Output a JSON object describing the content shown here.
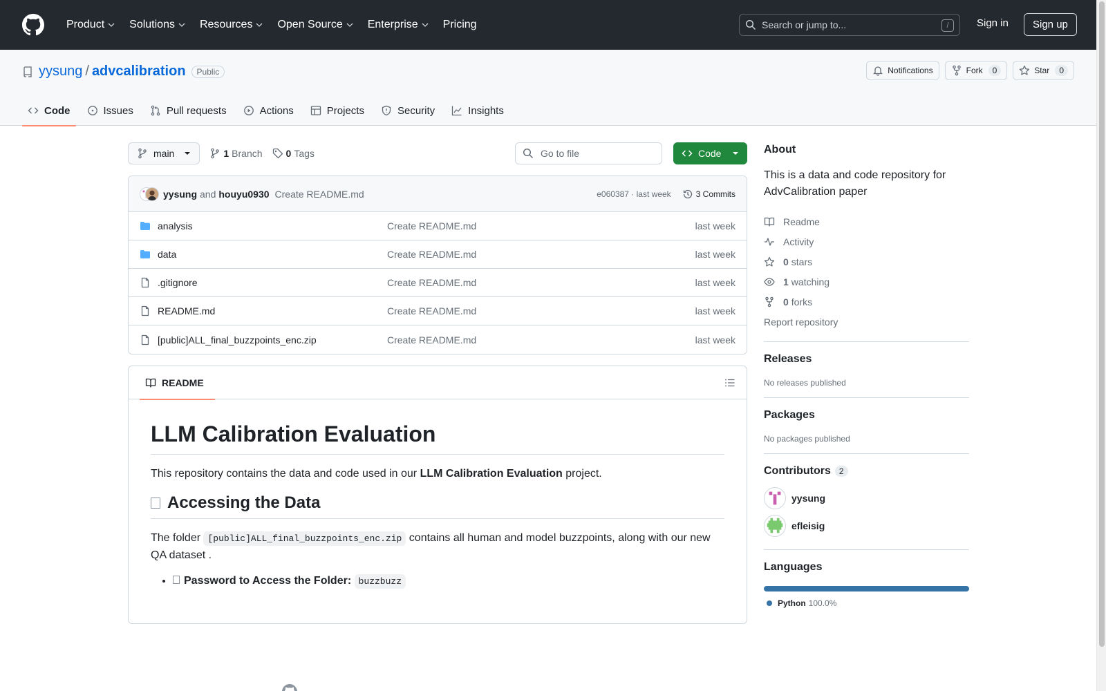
{
  "header": {
    "nav": [
      {
        "label": "Product",
        "has_menu": true
      },
      {
        "label": "Solutions",
        "has_menu": true
      },
      {
        "label": "Resources",
        "has_menu": true
      },
      {
        "label": "Open Source",
        "has_menu": true
      },
      {
        "label": "Enterprise",
        "has_menu": true
      },
      {
        "label": "Pricing",
        "has_menu": false
      }
    ],
    "search_placeholder": "Search or jump to...",
    "search_shortcut": "/",
    "sign_in": "Sign in",
    "sign_up": "Sign up"
  },
  "repo": {
    "owner": "yysung",
    "separator": "/",
    "name": "advcalibration",
    "visibility": "Public",
    "notifications_label": "Notifications",
    "fork_label": "Fork",
    "fork_count": "0",
    "star_label": "Star",
    "star_count": "0",
    "tabs": [
      {
        "label": "Code",
        "icon": "code-icon"
      },
      {
        "label": "Issues",
        "icon": "issue-icon"
      },
      {
        "label": "Pull requests",
        "icon": "pull-request-icon"
      },
      {
        "label": "Actions",
        "icon": "play-icon"
      },
      {
        "label": "Projects",
        "icon": "table-icon"
      },
      {
        "label": "Security",
        "icon": "shield-icon"
      },
      {
        "label": "Insights",
        "icon": "graph-icon"
      }
    ],
    "active_tab": "Code"
  },
  "toolbar": {
    "branch": "main",
    "branch_count": "1",
    "branch_label": "Branch",
    "tag_count": "0",
    "tag_label": "Tags",
    "goto_placeholder": "Go to file",
    "code_button": "Code"
  },
  "commit": {
    "author1": "yysung",
    "and": "and",
    "author2": "houyu0930",
    "message": "Create README.md",
    "sha_time": "e060387 · last week",
    "commits_label": "3 Commits"
  },
  "files": [
    {
      "name": "analysis",
      "type": "folder",
      "message": "Create README.md",
      "date": "last week"
    },
    {
      "name": "data",
      "type": "folder",
      "message": "Create README.md",
      "date": "last week"
    },
    {
      "name": ".gitignore",
      "type": "file",
      "message": "Create README.md",
      "date": "last week"
    },
    {
      "name": "README.md",
      "type": "file",
      "message": "Create README.md",
      "date": "last week"
    },
    {
      "name": "[public]ALL_final_buzzpoints_enc.zip",
      "type": "file",
      "message": "Create README.md",
      "date": "last week"
    }
  ],
  "readme": {
    "tab_label": "README",
    "h1": "LLM Calibration Evaluation",
    "intro_before": "This repository contains the data and code used in our ",
    "intro_bold": "LLM Calibration Evaluation",
    "intro_after": " project.",
    "h2": "Accessing the Data",
    "p2_before": "The folder ",
    "p2_code": "[public]ALL_final_buzzpoints_enc.zip",
    "p2_after": " contains all human and model buzzpoints, along with our new QA dataset .",
    "bullet_label": "Password to Access the Folder:",
    "bullet_code": "buzzbuzz"
  },
  "about": {
    "heading": "About",
    "description": "This is a data and code repository for AdvCalibration paper",
    "readme": "Readme",
    "activity": "Activity",
    "stars_count": "0",
    "stars_label": "stars",
    "watching_count": "1",
    "watching_label": "watching",
    "forks_count": "0",
    "forks_label": "forks",
    "report": "Report repository"
  },
  "releases": {
    "heading": "Releases",
    "text": "No releases published"
  },
  "packages": {
    "heading": "Packages",
    "text": "No packages published"
  },
  "contributors": {
    "heading": "Contributors",
    "count": "2",
    "list": [
      {
        "name": "yysung"
      },
      {
        "name": "efleisig"
      }
    ]
  },
  "languages": {
    "heading": "Languages",
    "list": [
      {
        "name": "Python",
        "percent": "100.0%",
        "color": "#3572A5"
      }
    ]
  },
  "colors": {
    "header_bg": "#24292f",
    "link": "#0969da",
    "green": "#1f883d",
    "tab_underline": "#fd8c73",
    "folder": "#54aeff"
  }
}
